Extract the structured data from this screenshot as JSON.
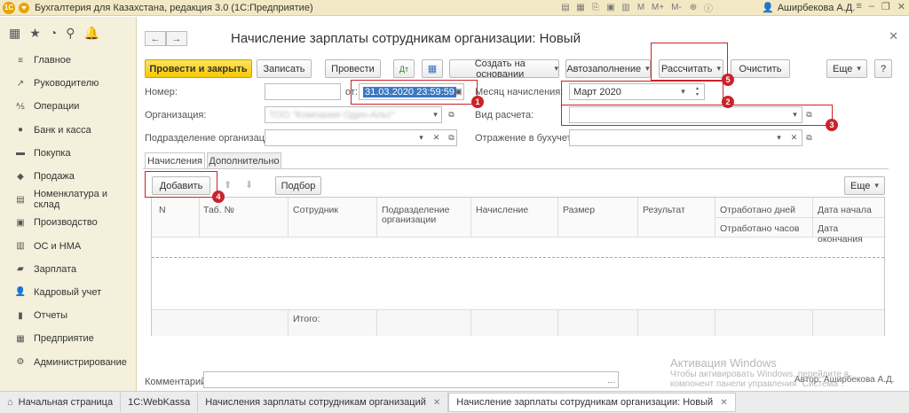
{
  "titlebar": {
    "logo": "1С",
    "title": "Бухгалтерия для Казахстана, редакция 3.0  (1С:Предприятие)",
    "tools": [
      "M",
      "M+",
      "M-"
    ],
    "user": "Аширбекова А.Д."
  },
  "sidebar": {
    "items": [
      {
        "label": "Главное",
        "icon": "menu-icon"
      },
      {
        "label": "Руководителю",
        "icon": "chart-icon"
      },
      {
        "label": "Операции",
        "icon": "operations-icon"
      },
      {
        "label": "Банк и касса",
        "icon": "bank-icon"
      },
      {
        "label": "Покупка",
        "icon": "cart-icon"
      },
      {
        "label": "Продажа",
        "icon": "sale-icon"
      },
      {
        "label": "Номенклатура и склад",
        "icon": "warehouse-icon"
      },
      {
        "label": "Производство",
        "icon": "production-icon"
      },
      {
        "label": "ОС и НМА",
        "icon": "assets-icon"
      },
      {
        "label": "Зарплата",
        "icon": "salary-icon"
      },
      {
        "label": "Кадровый учет",
        "icon": "personnel-icon"
      },
      {
        "label": "Отчеты",
        "icon": "reports-icon"
      },
      {
        "label": "Предприятие",
        "icon": "enterprise-icon"
      },
      {
        "label": "Администрирование",
        "icon": "gear-icon"
      }
    ]
  },
  "form": {
    "title": "Начисление зарплаты сотрудникам организации: Новый",
    "toolbar": {
      "post_close": "Провести и закрыть",
      "save": "Записать",
      "post": "Провести",
      "create_based": "Создать на основании",
      "autofill": "Автозаполнение",
      "calculate": "Рассчитать",
      "clear": "Очистить",
      "more": "Еще",
      "help": "?"
    },
    "fields": {
      "number_label": "Номер:",
      "number_value": "",
      "date_label": "от:",
      "date_value": "31.03.2020 23:59:59",
      "month_label": "Месяц начисления:",
      "month_value": "Март 2020",
      "org_label": "Организация:",
      "org_value": "ТОО \"Компания Один-Альт\"",
      "calc_type_label": "Вид расчета:",
      "calc_type_value": "",
      "dept_label": "Подразделение организации:",
      "dept_value": "",
      "reflection_label": "Отражение в бухучете:",
      "reflection_value": ""
    },
    "tabs": [
      {
        "label": "Начисления"
      },
      {
        "label": "Дополнительно"
      }
    ],
    "table_toolbar": {
      "add": "Добавить",
      "pick": "Подбор",
      "more": "Еще"
    },
    "columns": {
      "n": "N",
      "tab_no": "Таб. №",
      "employee": "Сотрудник",
      "dept_line1": "Подразделение",
      "dept_line2": "организации",
      "accrual": "Начисление",
      "size": "Размер",
      "result": "Результат",
      "days": "Отработано дней",
      "hours": "Отработано часов",
      "date_start": "Дата начала",
      "date_end": "Дата окончания"
    },
    "total_label": "Итого:",
    "comment_label": "Комментарий:",
    "author": "Автор: Аширбекова А.Д."
  },
  "annotations": [
    "1",
    "2",
    "3",
    "4",
    "5"
  ],
  "watermark": {
    "title": "Активация Windows",
    "line1": "Чтобы активировать Windows, перейдите в",
    "line2": "компонент панели управления \"Система\"."
  },
  "taskbar": {
    "items": [
      {
        "label": "Начальная страница"
      },
      {
        "label": "1С:WebKassa"
      },
      {
        "label": "Начисления зарплаты сотрудникам организаций"
      },
      {
        "label": "Начисление зарплаты сотрудникам организации: Новый"
      }
    ]
  },
  "colors": {
    "primary_button": "#f7c800",
    "annotation": "#c9242a",
    "selection": "#3a78c4",
    "panel": "#f4f0dc"
  }
}
